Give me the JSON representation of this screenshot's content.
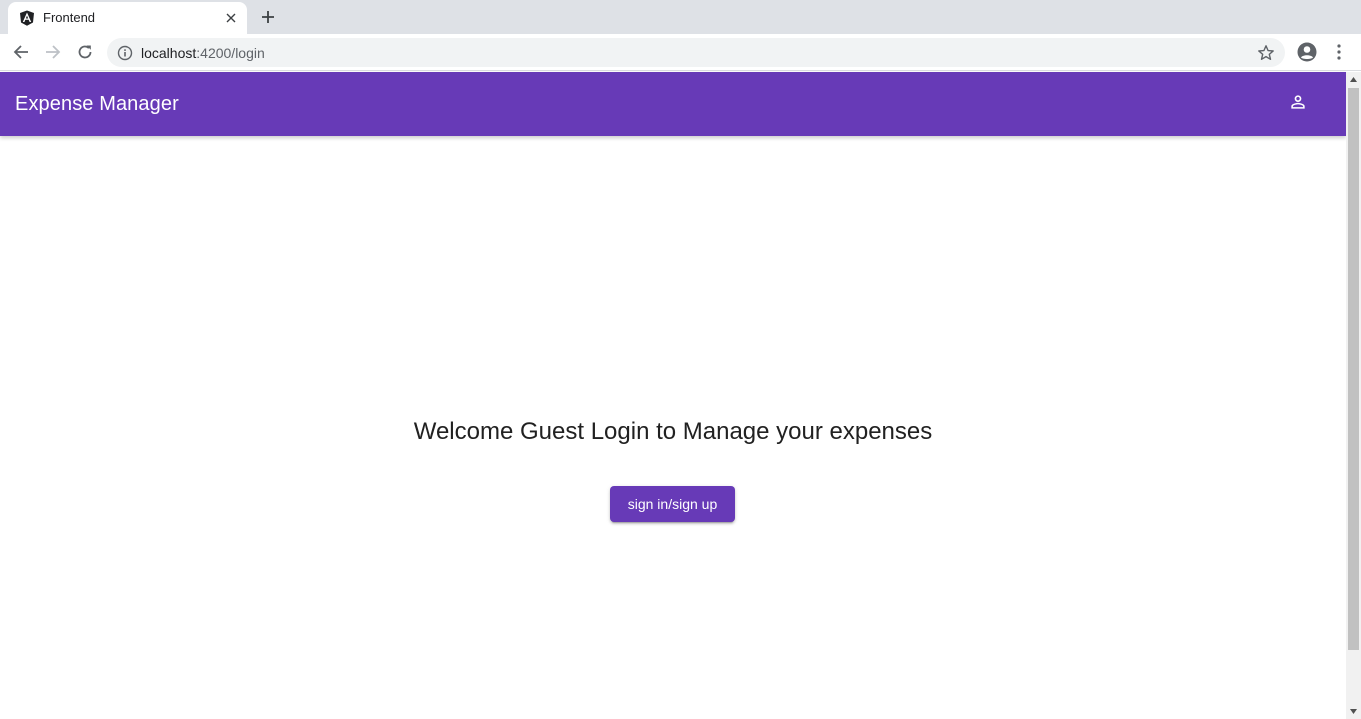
{
  "browser": {
    "tab": {
      "title": "Frontend",
      "favicon": "angular-icon"
    },
    "url": {
      "host": "localhost",
      "path": ":4200/login"
    },
    "icons": {
      "back": "arrow-left-icon",
      "forward": "arrow-right-icon",
      "reload": "reload-icon",
      "info": "info-icon",
      "bookmark": "star-icon",
      "profile": "account-circle-icon",
      "menu": "kebab-menu-icon",
      "close_tab": "close-icon",
      "new_tab": "plus-icon"
    }
  },
  "app": {
    "title": "Expense Manager",
    "account_icon": "person-icon",
    "primary_color": "#673ab7"
  },
  "main": {
    "welcome_text": "Welcome Guest Login to Manage your expenses",
    "signin_label": "sign in/sign up"
  }
}
